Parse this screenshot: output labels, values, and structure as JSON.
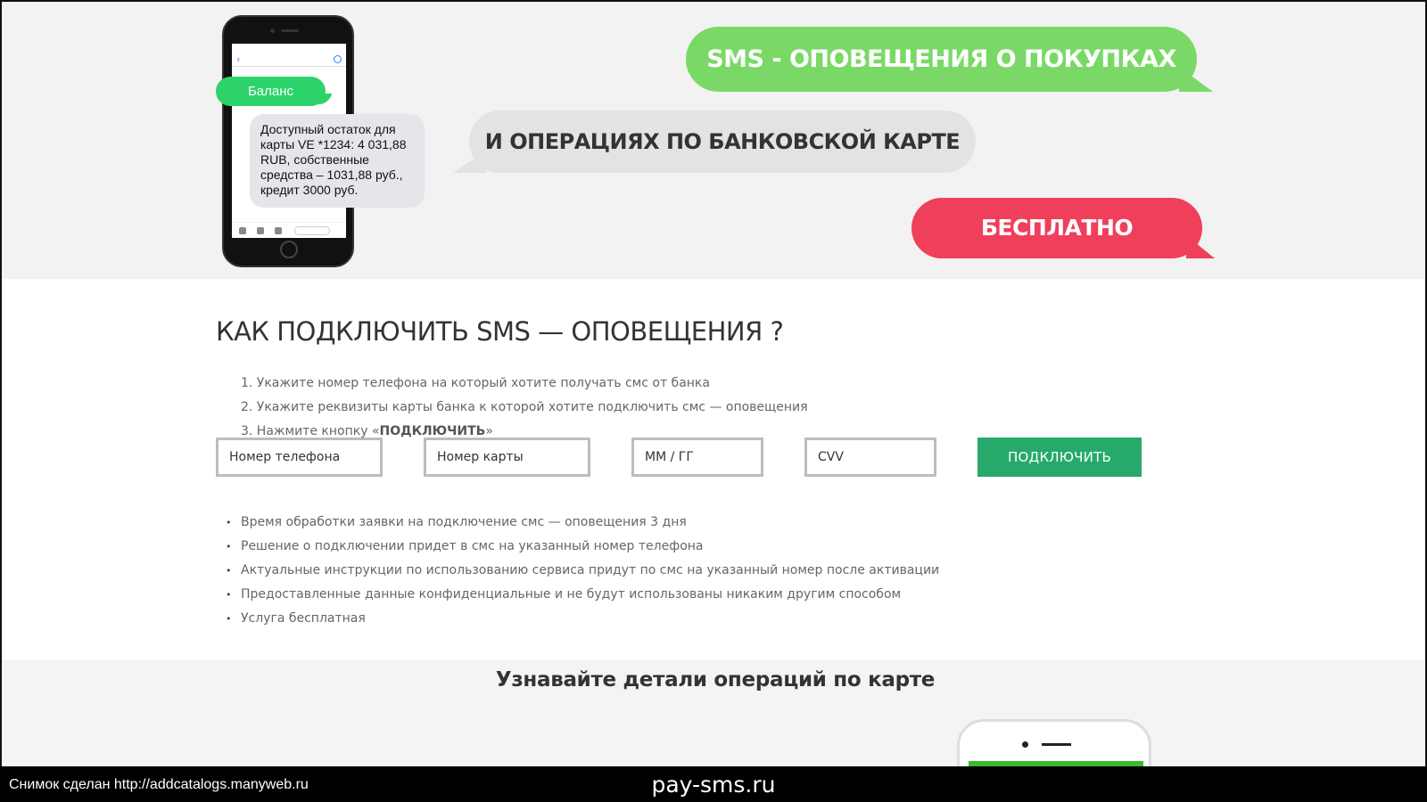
{
  "hero": {
    "phone_bubble_label": "Баланс",
    "sms_text_lines": [
      "Доступный остаток для",
      "карты VE *1234: 4 031,88",
      "RUB, собственные",
      "средства – 1031,88 руб.,",
      "кредит 3000 руб."
    ],
    "banner_green": "SMS - ОПОВЕЩЕНИЯ О ПОКУПКАХ",
    "banner_gray": "И  ОПЕРАЦИЯХ ПО БАНКОВСКОЙ КАРТЕ",
    "banner_red": "БЕСПЛАТНО"
  },
  "howto": {
    "title": "КАК ПОДКЛЮЧИТЬ SMS — ОПОВЕЩЕНИЯ ?",
    "steps": [
      "1. Укажите номер телефона на который хотите получать смс от банка",
      "2. Укажите реквизиты карты банка к которой хотите подключить смс — оповещения"
    ],
    "step3_prefix": "3. Нажмите кнопку «",
    "step3_bold": "ПОДКЛЮЧИТЬ",
    "step3_suffix": "»",
    "form": {
      "phone_placeholder": "Номер телефона",
      "card_placeholder": "Номер карты",
      "expiry_placeholder": "ММ / ГГ",
      "cvv_placeholder": "CVV",
      "submit_label": "ПОДКЛЮЧИТЬ"
    },
    "notes": [
      "Время обработки заявки на подключение смс — оповещения 3 дня",
      "Решение о подключении придет в смс на указанный номер телефона",
      "Актуальные инструкции по использованию сервиса придут по смс на указанный номер после активации",
      "Предоставленные данные конфиденциальные и не будут использованы никаким другим способом",
      "Услуга бесплатная"
    ]
  },
  "details": {
    "title": "Узнавайте детали операций по карте"
  },
  "footer": {
    "credit": "Снимок сделан http://addcatalogs.manyweb.ru",
    "domain": "pay-sms.ru"
  },
  "colors": {
    "green_banner": "#7ad966",
    "red_banner": "#ef3f5b",
    "gray_banner": "#e3e3e3",
    "button": "#27a96c",
    "imessage_green": "#2bd36a"
  }
}
